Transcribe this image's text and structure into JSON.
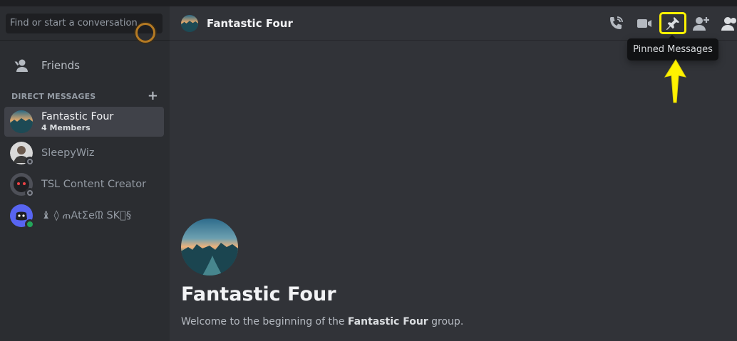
{
  "sidebar": {
    "search_placeholder": "Find or start a conversation",
    "friends_label": "Friends",
    "dm_header": "DIRECT MESSAGES",
    "dms": [
      {
        "name": "Fantastic Four",
        "sub": "4 Members",
        "active": true,
        "status": null
      },
      {
        "name": "SleepyWiz",
        "status": "offline"
      },
      {
        "name": "TSL Content Creator",
        "status": "offline"
      },
      {
        "name": "♝ ◊ ጠAtΣeᙢ SK⃣§",
        "status": "online"
      }
    ]
  },
  "header": {
    "title": "Fantastic Four",
    "icons": [
      "voice-call-icon",
      "video-call-icon",
      "pin-icon",
      "add-friend-icon",
      "members-icon"
    ]
  },
  "tooltip": {
    "text": "Pinned Messages"
  },
  "welcome": {
    "title": "Fantastic Four",
    "text_before": "Welcome to the beginning of the ",
    "group_name": "Fantastic Four",
    "text_after": " group."
  },
  "colors": {
    "accent_highlight": "#fff200",
    "online": "#23a55a",
    "offline": "#80848e",
    "active_bg": "#404249"
  }
}
